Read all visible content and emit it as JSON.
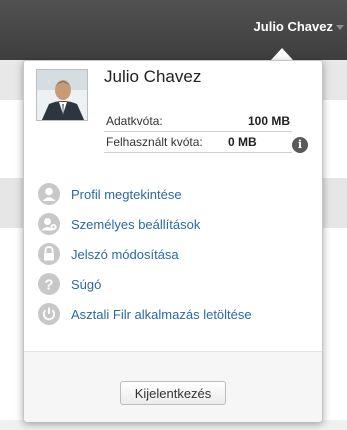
{
  "topbar": {
    "user_name": "Julio Chavez"
  },
  "popup": {
    "name": "Julio Chavez",
    "quota": [
      {
        "label": "Adatkvóta:",
        "value": "100 MB"
      },
      {
        "label": "Felhasznált kvóta:",
        "value": "0 MB"
      }
    ],
    "info_icon_glyph": "i",
    "menu": [
      {
        "label": "Profil megtekintése",
        "icon": "profile-icon"
      },
      {
        "label": "Személyes beállítások",
        "icon": "personal-settings-icon"
      },
      {
        "label": "Jelszó módosítása",
        "icon": "lock-icon"
      },
      {
        "label": "Súgó",
        "icon": "help-icon"
      },
      {
        "label": "Asztali Filr alkalmazás letöltése",
        "icon": "power-icon"
      }
    ],
    "logout_label": "Kijelentkezés"
  },
  "colors": {
    "topbar": "#444444",
    "link": "#2a6aa6",
    "icon_gray": "#c8c8c8"
  }
}
